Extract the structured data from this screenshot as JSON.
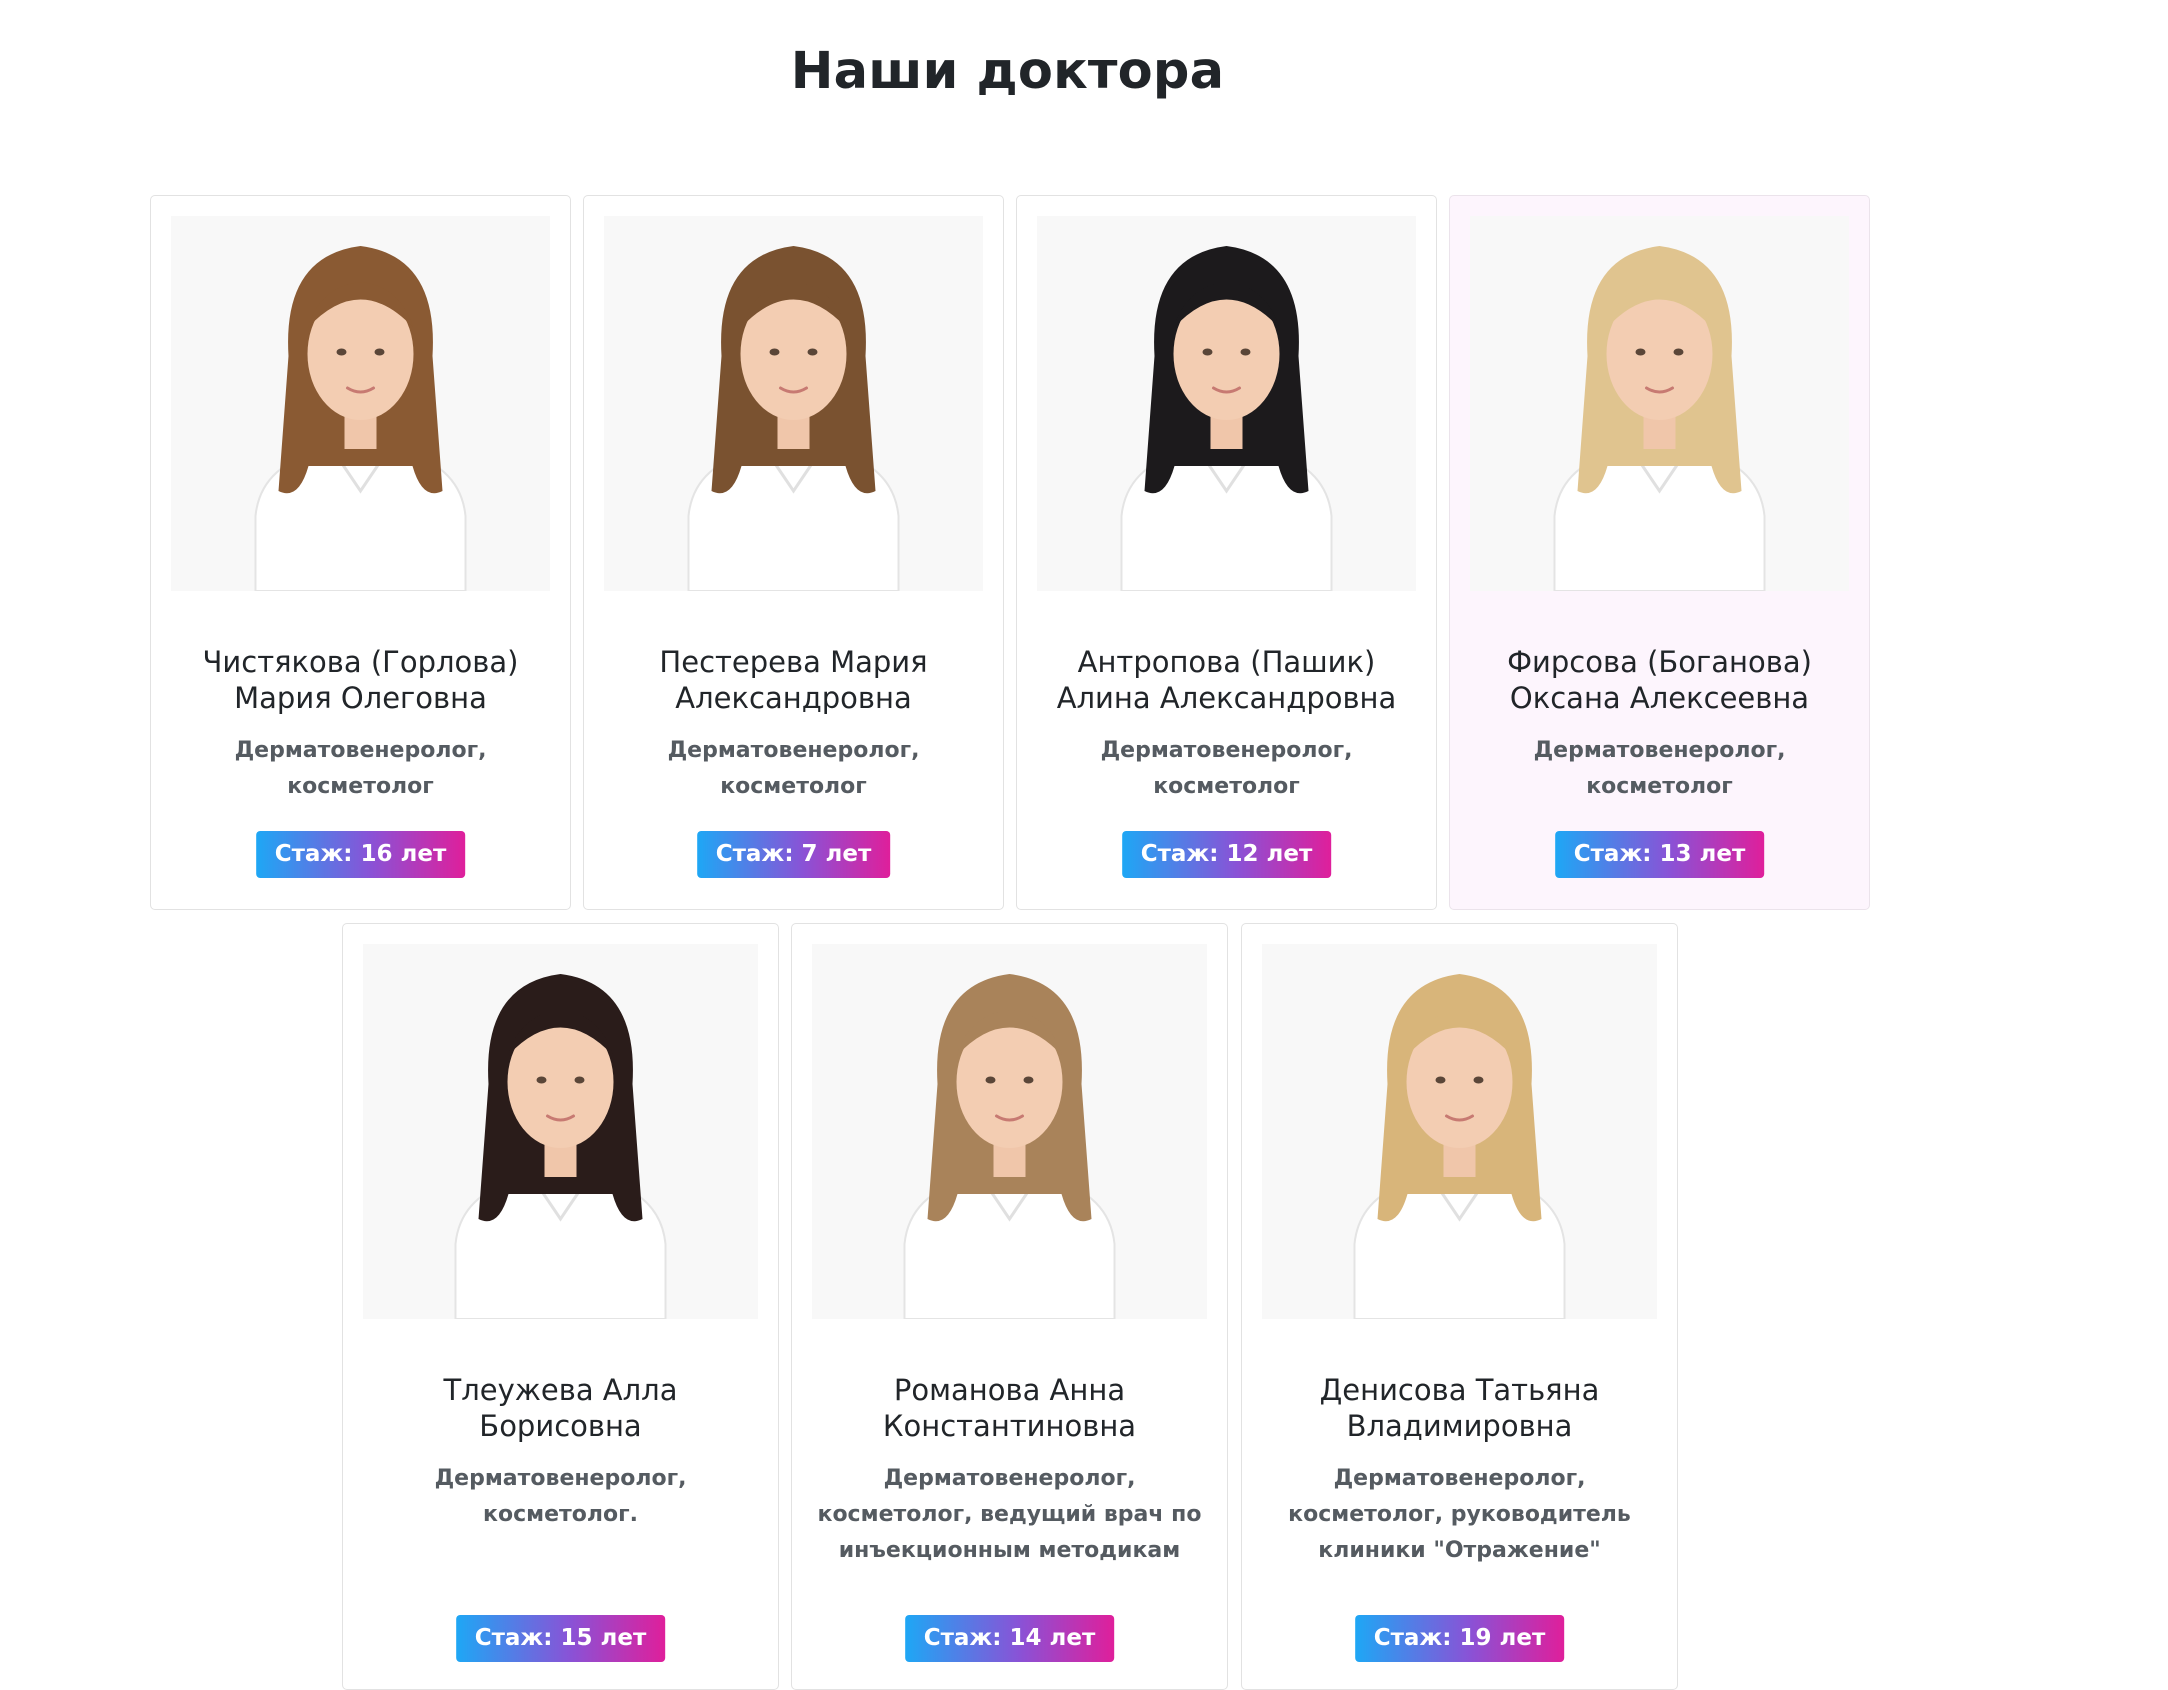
{
  "page": {
    "title": "Наши доктора"
  },
  "doctors": [
    {
      "name_line1": "Чистякова (Горлова)",
      "name_line2": "Мария Олеговна",
      "spec_lines": [
        "Дерматовенеролог,",
        "косметолог"
      ],
      "experience": "Стаж: 16 лет",
      "hair_color": "#8a5a33"
    },
    {
      "name_line1": "Пестерева Мария",
      "name_line2": "Александровна",
      "spec_lines": [
        "Дерматовенеролог,",
        "косметолог"
      ],
      "experience": "Стаж: 7 лет",
      "hair_color": "#7a5230"
    },
    {
      "name_line1": "Антропова (Пашик)",
      "name_line2": "Алина Александровна",
      "spec_lines": [
        "Дерматовенеролог,",
        "косметолог"
      ],
      "experience": "Стаж: 12 лет",
      "hair_color": "#1c1a1c"
    },
    {
      "name_line1": "Фирсова (Боганова)",
      "name_line2": "Оксана Алексеевна",
      "spec_lines": [
        "Дерматовенеролог,",
        "косметолог"
      ],
      "experience": "Стаж: 13 лет",
      "hair_color": "#e0c48f"
    },
    {
      "name_line1": "Тлеужева Алла",
      "name_line2": "Борисовна",
      "spec_lines": [
        "Дерматовенеролог,",
        "косметолог."
      ],
      "experience": "Стаж: 15 лет",
      "hair_color": "#2a1c1a"
    },
    {
      "name_line1": "Романова Анна",
      "name_line2": "Константиновна",
      "spec_lines": [
        "Дерматовенеролог,",
        "косметолог, ведущий врач по",
        "инъекционным методикам"
      ],
      "experience": "Стаж: 14 лет",
      "hair_color": "#a9835a"
    },
    {
      "name_line1": "Денисова Татьяна",
      "name_line2": "Владимировна",
      "spec_lines": [
        "Дерматовенеролог,",
        "косметолог, руководитель",
        "клиники \"Отражение\""
      ],
      "experience": "Стаж: 19 лет",
      "hair_color": "#d8b57a"
    }
  ],
  "colors": {
    "badge_gradient_start": "#1ea7f5",
    "badge_gradient_end": "#df1f9b",
    "highlight_card_bg": "#fdf5fd"
  }
}
